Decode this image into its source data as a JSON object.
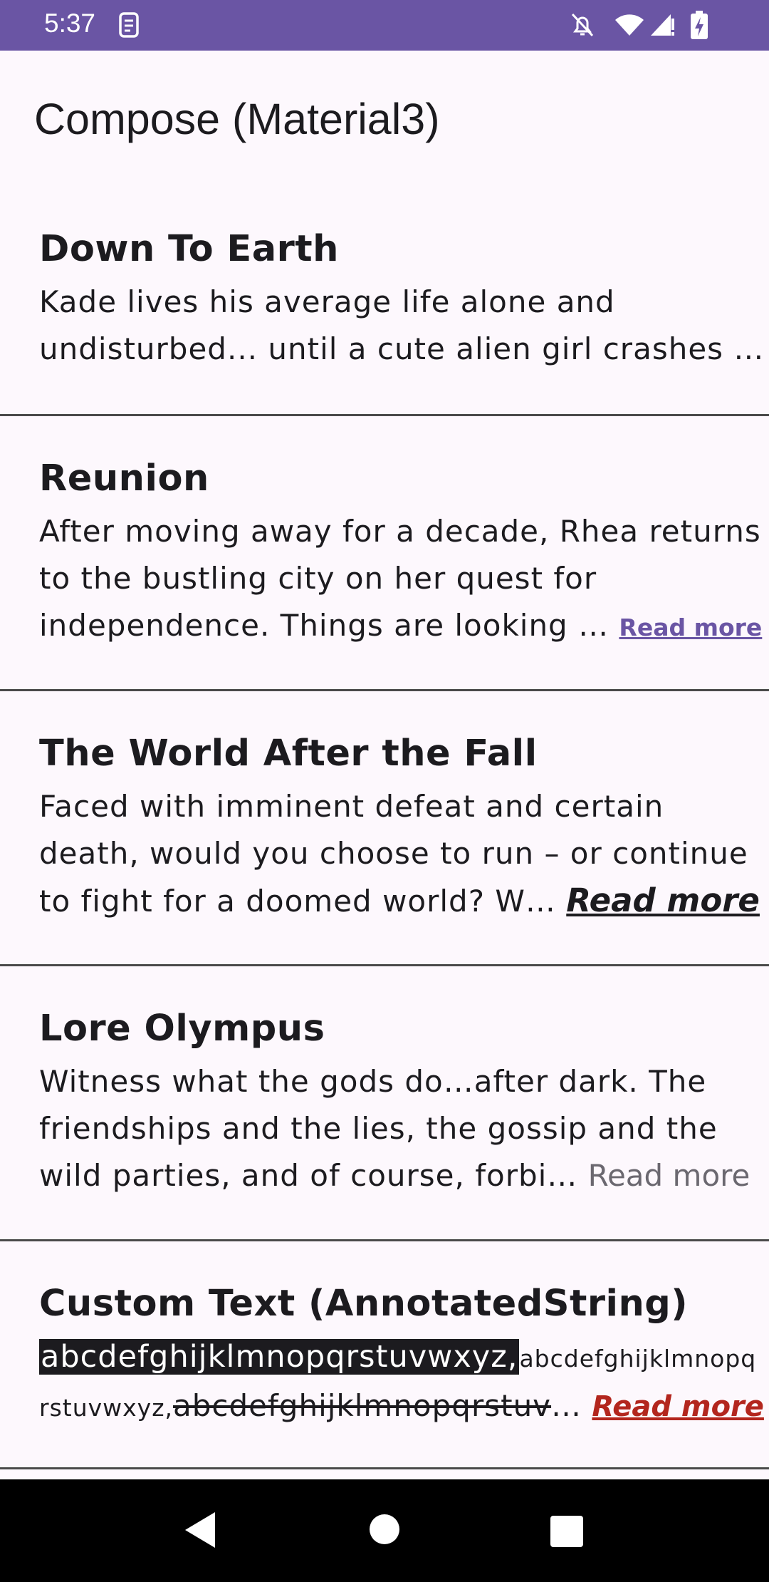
{
  "status_bar": {
    "time": "5:37",
    "icons": [
      "sim-card-icon",
      "notifications-off-icon",
      "wifi-icon",
      "signal-icon",
      "battery-charging-icon"
    ],
    "background": "#6a55a4"
  },
  "app": {
    "title": "Compose (Material3)"
  },
  "items": [
    {
      "title": "Down To Earth",
      "lines": [
        "Kade lives his average life alone and",
        "undisturbed... until a cute alien girl crashes …"
      ]
    },
    {
      "title": "Reunion",
      "lines": [
        "After moving away for a decade, Rhea returns",
        "to the bustling city on her quest for",
        "independence. Things are looking … "
      ],
      "read_more": "Read more"
    },
    {
      "title": "The World After the Fall",
      "lines": [
        "Faced with imminent defeat and certain",
        "death, would you choose to run – or continue",
        "to fight for a doomed world? W… "
      ],
      "read_more": "Read more"
    },
    {
      "title": "Lore Olympus",
      "lines": [
        "Witness what the gods do…after dark. The",
        "friendships and the lies, the gossip and the",
        "wild parties, and of course, forbi… "
      ],
      "read_more": "Read more"
    },
    {
      "title": "Custom Text (AnnotatedString)",
      "highlight": "abcdefghijklmnopqrstuvwxyz,",
      "small_a": "abcdefghijklmnopq",
      "small_b": "rstuvwxyz,",
      "strike": "abcdefghijklmnopqrstuv",
      "ellipsis": "… ",
      "read_more": "Read more"
    }
  ],
  "nav_bar": {
    "buttons": [
      "back-icon",
      "home-icon",
      "recents-icon"
    ]
  }
}
